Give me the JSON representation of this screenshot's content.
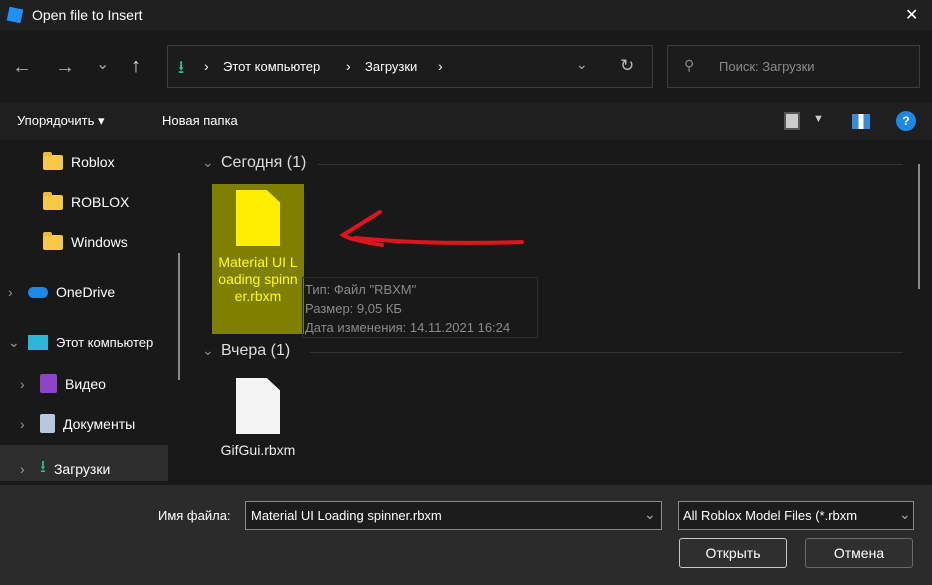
{
  "window": {
    "title": "Open file to Insert",
    "close": "✕"
  },
  "nav": {
    "back": "←",
    "forward": "→",
    "recent": "⌄",
    "up": "↑",
    "breadcrumb": [
      "Этот компьютер",
      "Загрузки"
    ],
    "sep": "›",
    "search_placeholder": "Поиск: Загрузки"
  },
  "toolbar": {
    "organize": "Упорядочить ▾",
    "new_folder": "Новая папка",
    "help": "?"
  },
  "sidebar": {
    "items": [
      {
        "label": "Roblox"
      },
      {
        "label": "ROBLOX"
      },
      {
        "label": "Windows"
      },
      {
        "label": "OneDrive"
      },
      {
        "label": "Этот компьютер"
      },
      {
        "label": "Видео"
      },
      {
        "label": "Документы"
      },
      {
        "label": "Загрузки"
      }
    ]
  },
  "groups": [
    {
      "title": "Сегодня (1)",
      "files": [
        {
          "name": "Material UI Loading spinner.rbxm",
          "tooltip": [
            "Тип: Файл \"RBXM\"",
            "Размер: 9,05 КБ",
            "Дата изменения: 14.11.2021 16:24"
          ]
        }
      ]
    },
    {
      "title": "Вчера (1)",
      "files": [
        {
          "name": "GifGui.rbxm"
        }
      ]
    }
  ],
  "bottom": {
    "filename_label": "Имя файла:",
    "filename_value": "Material UI Loading spinner.rbxm",
    "filter": "All Roblox Model Files (*.rbxm",
    "open": "Открыть",
    "cancel": "Отмена"
  },
  "colors": {
    "accent": "#0078d4",
    "selection": "#808000",
    "selected_text": "#ffff00",
    "arrow": "#e0141e"
  }
}
